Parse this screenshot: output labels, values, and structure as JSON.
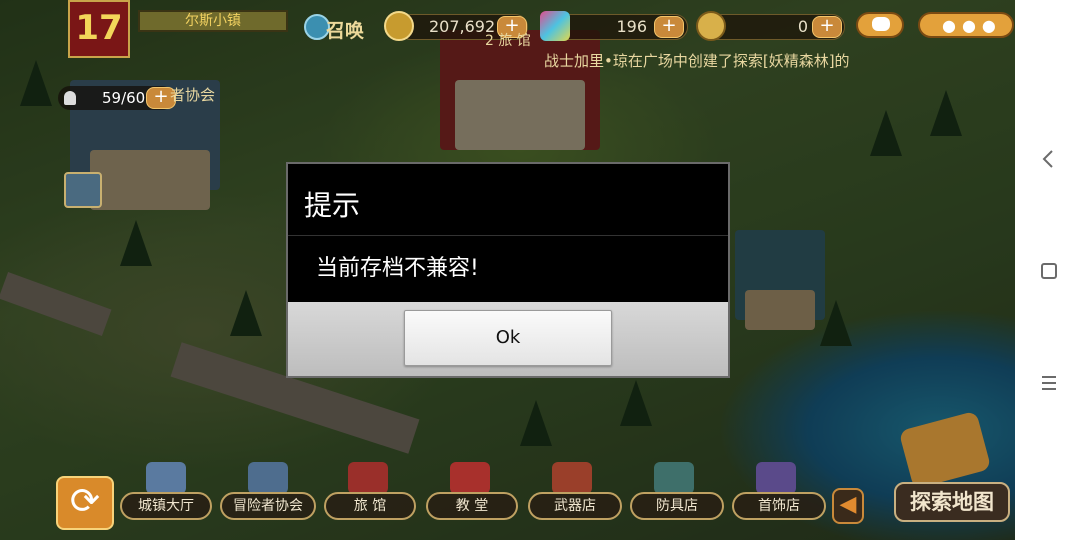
{
  "hud": {
    "level": "17",
    "town_name": "尔斯小镇",
    "summon_label": "召唤",
    "gold": "207,692",
    "gems": "196",
    "keys": "0",
    "population": "59/60",
    "plus": "+"
  },
  "ticker": {
    "text": "战士加里•琼在广场中创建了探索[妖精森林]的"
  },
  "map_labels": {
    "inn": "2  旅 馆",
    "guild": "者协会"
  },
  "bottom_bar": {
    "items": [
      {
        "label": "城镇大厅"
      },
      {
        "label": "冒险者协会"
      },
      {
        "label": "旅  馆"
      },
      {
        "label": "教  堂"
      },
      {
        "label": "武器店"
      },
      {
        "label": "防具店"
      },
      {
        "label": "首饰店"
      }
    ],
    "explore_label": "探索地图"
  },
  "dialog": {
    "title": "提示",
    "message": "当前存档不兼容!",
    "ok_label": "Ok"
  },
  "colors": {
    "dialog_bg": "#000000",
    "dialog_footer": "#c8c8c8",
    "hud_gold": "#f3d659",
    "accent_orange": "#e3a13b"
  }
}
